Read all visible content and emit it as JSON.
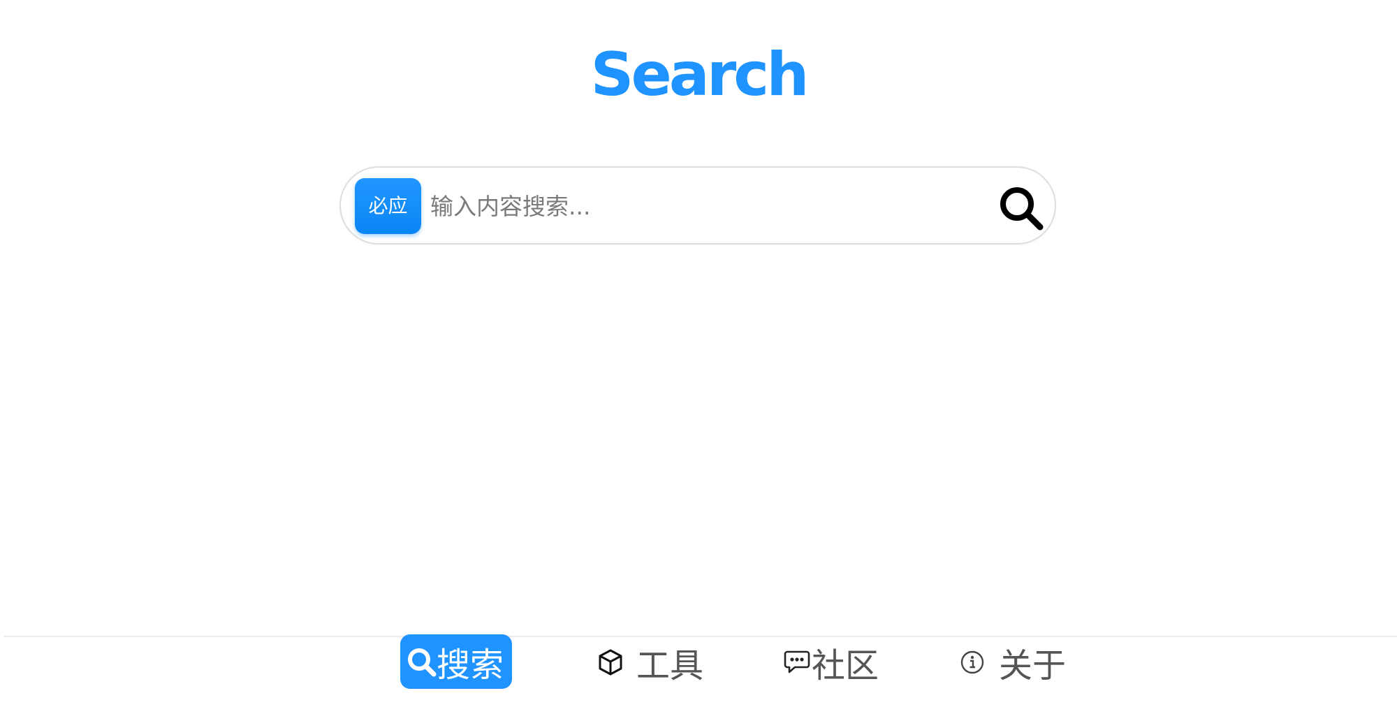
{
  "header": {
    "logo_text": "Search"
  },
  "search": {
    "engine_label": "必应",
    "placeholder": "输入内容搜索...",
    "value": "",
    "submit_icon": "search-icon"
  },
  "nav": {
    "items": [
      {
        "label": "搜索",
        "icon": "search-icon",
        "active": true
      },
      {
        "label": "工具",
        "icon": "cube-icon",
        "active": false
      },
      {
        "label": "社区",
        "icon": "chat-bubble-icon",
        "active": false
      },
      {
        "label": "关于",
        "icon": "info-icon",
        "active": false
      }
    ]
  },
  "colors": {
    "accent": "#1f93ff",
    "nav_text": "#555555",
    "border": "#dedede"
  }
}
